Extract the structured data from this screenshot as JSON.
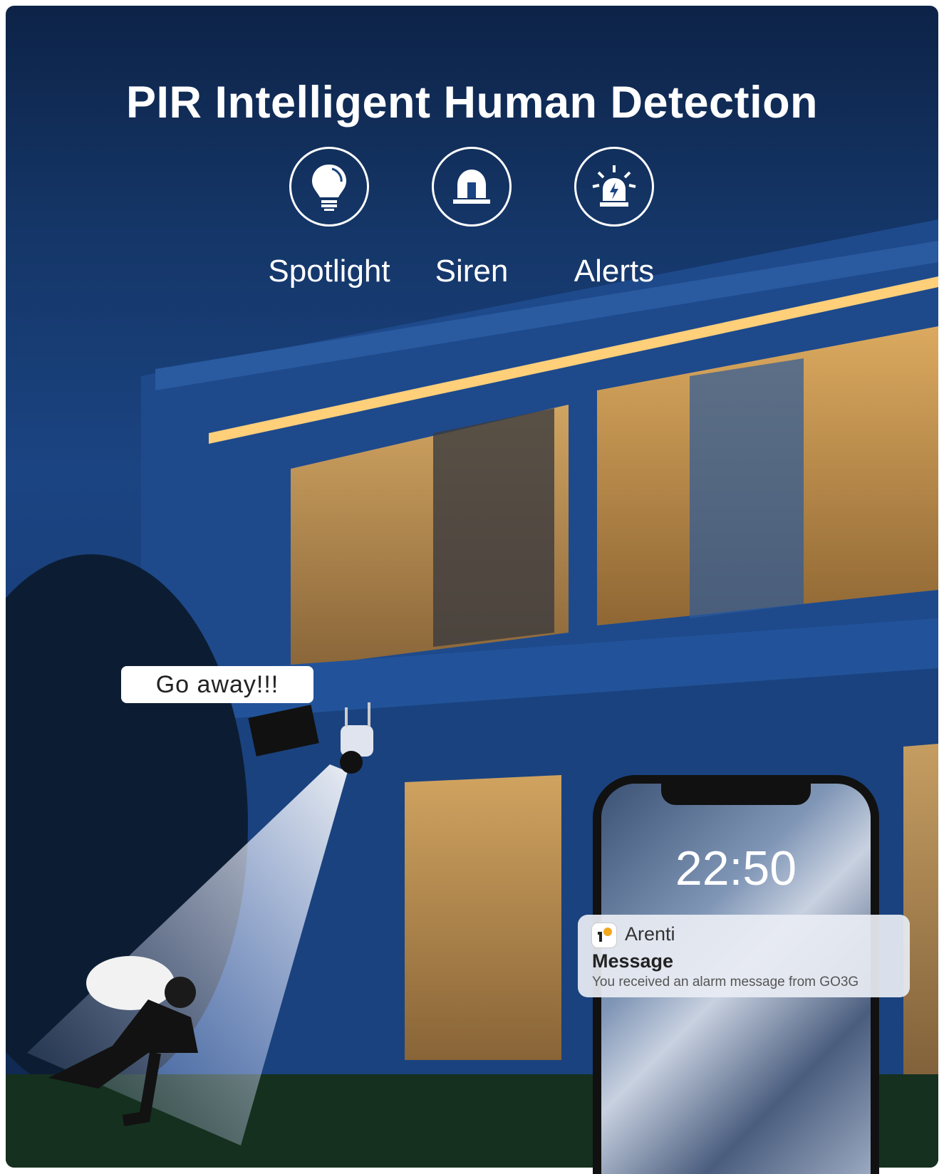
{
  "headline": "PIR Intelligent Human Detection",
  "features": [
    {
      "label": "Spotlight",
      "icon": "lightbulb-icon"
    },
    {
      "label": "Siren",
      "icon": "siren-icon"
    },
    {
      "label": "Alerts",
      "icon": "alarm-light-icon"
    }
  ],
  "speech_bubble": "Go away!!!",
  "phone": {
    "time": "22:50",
    "notification": {
      "app": "Arenti",
      "title": "Message",
      "body": "You received an alarm message from GO3G"
    }
  },
  "colors": {
    "sky": "#143566",
    "house": "#1e4a8c",
    "warm_light": "#e8a94a",
    "logo_accent": "#f2a81d"
  }
}
